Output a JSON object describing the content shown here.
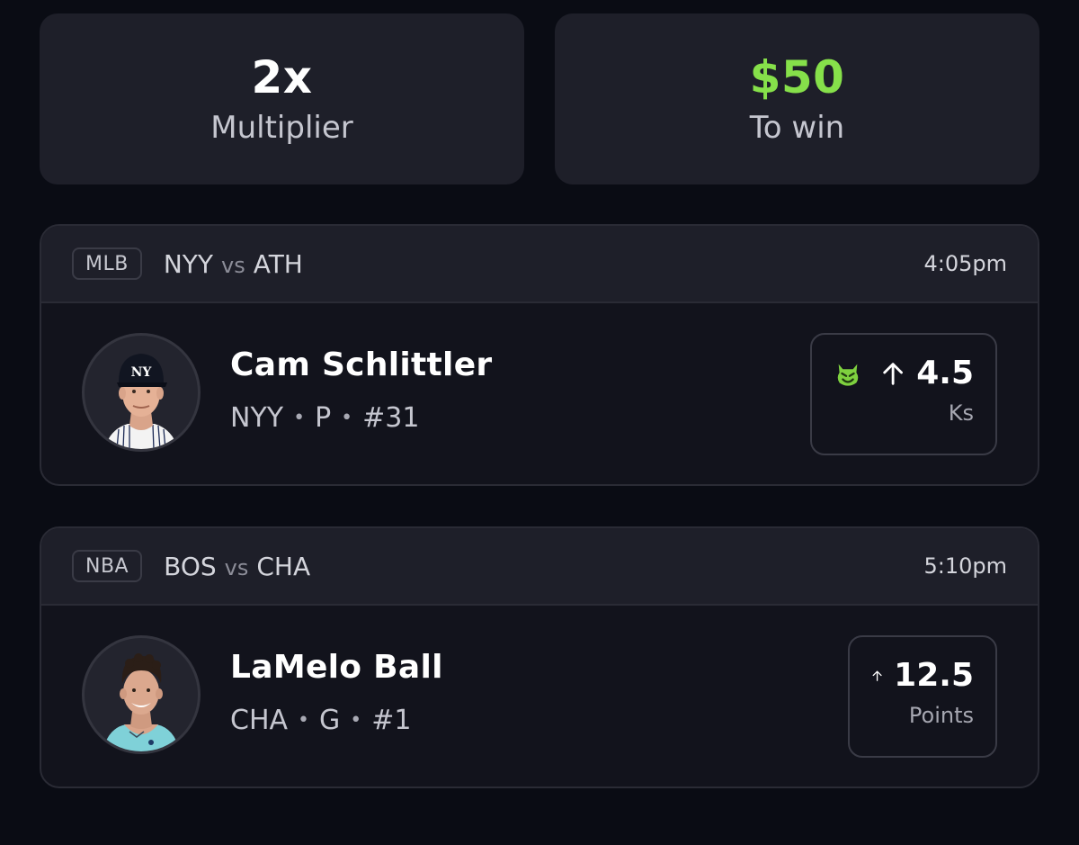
{
  "summary": {
    "multiplier_value": "2x",
    "multiplier_label": "Multiplier",
    "payout_value": "$50",
    "payout_label": "To win"
  },
  "colors": {
    "payout_accent": "#86e04a",
    "card_background": "#1e1f29",
    "page_background": "#0a0c14"
  },
  "picks": [
    {
      "league": "MLB",
      "team_a": "NYY",
      "vs": "vs",
      "team_b": "ATH",
      "time": "4:05pm",
      "player_name": "Cam Schlittler",
      "team": "NYY",
      "position": "P",
      "number": "#31",
      "direction_icon": "arrow-up-icon",
      "modifier_icon": "demon-icon",
      "line": "4.5",
      "stat": "Ks"
    },
    {
      "league": "NBA",
      "team_a": "BOS",
      "vs": "vs",
      "team_b": "CHA",
      "time": "5:10pm",
      "player_name": "LaMelo Ball",
      "team": "CHA",
      "position": "G",
      "number": "#1",
      "direction_icon": "arrow-up-icon",
      "line": "12.5",
      "stat": "Points"
    }
  ],
  "separator": "•"
}
